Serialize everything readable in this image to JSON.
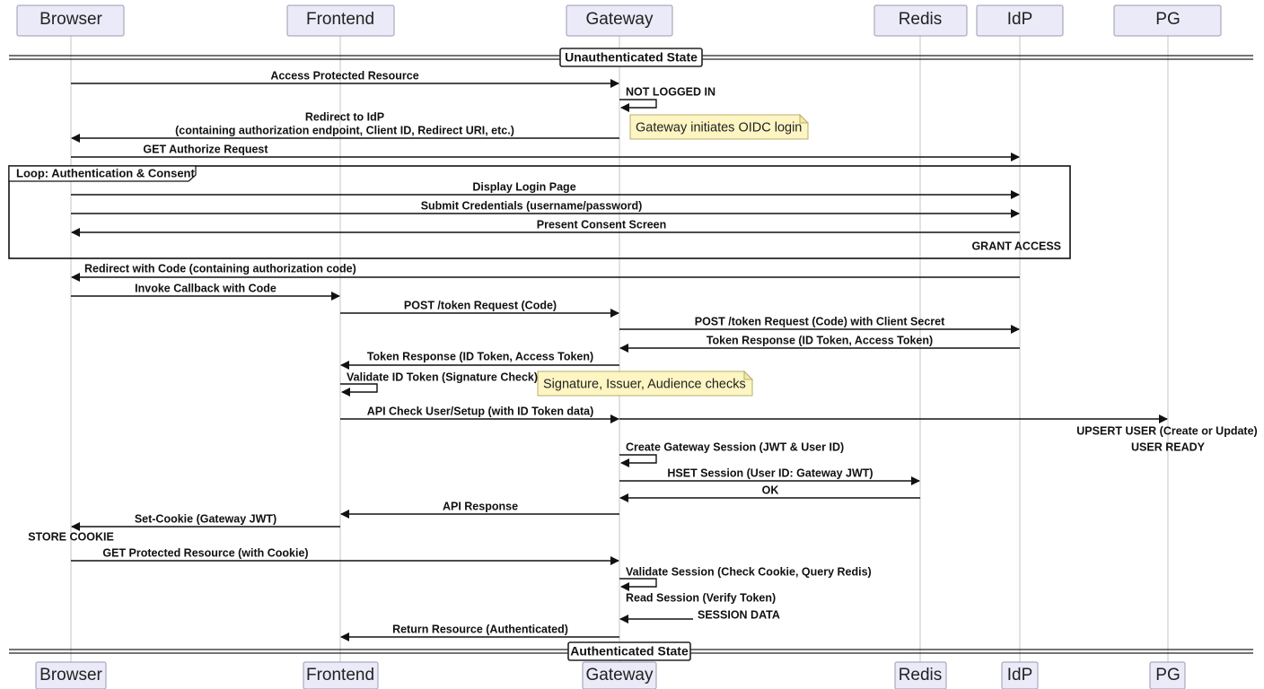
{
  "participants": [
    {
      "id": "browser",
      "label": "Browser"
    },
    {
      "id": "frontend",
      "label": "Frontend"
    },
    {
      "id": "gateway",
      "label": "Gateway"
    },
    {
      "id": "redis",
      "label": "Redis"
    },
    {
      "id": "idp",
      "label": "IdP"
    },
    {
      "id": "pg",
      "label": "PG"
    }
  ],
  "dividers": {
    "top": "Unauthenticated State",
    "bottom": "Authenticated State"
  },
  "loop": {
    "label": "Loop: Authentication & Consent"
  },
  "messages": [
    {
      "from": "browser",
      "to": "gateway",
      "lines": [
        "Access Protected Resource"
      ]
    },
    {
      "from": "gateway",
      "to": "gateway",
      "lines": [
        "NOT LOGGED IN"
      ]
    },
    {
      "from": "gateway",
      "to": "browser",
      "lines": [
        "Redirect to IdP",
        "(containing authorization endpoint, Client ID, Redirect URI, etc.)"
      ]
    },
    {
      "from": "browser",
      "to": "idp",
      "lines": [
        "GET Authorize Request"
      ]
    },
    {
      "from": "browser",
      "to": "idp",
      "lines": [
        "Display Login Page"
      ]
    },
    {
      "from": "browser",
      "to": "idp",
      "lines": [
        "Submit Credentials (username/password)"
      ]
    },
    {
      "from": "idp",
      "to": "browser",
      "lines": [
        "Present Consent Screen"
      ]
    },
    {
      "from": "idp",
      "to": "browser",
      "lines": [
        "Redirect with Code (containing authorization code)"
      ]
    },
    {
      "from": "browser",
      "to": "frontend",
      "lines": [
        "Invoke Callback with Code"
      ]
    },
    {
      "from": "frontend",
      "to": "gateway",
      "lines": [
        "POST /token Request (Code)"
      ]
    },
    {
      "from": "gateway",
      "to": "idp",
      "lines": [
        "POST /token Request (Code) with Client Secret"
      ]
    },
    {
      "from": "idp",
      "to": "gateway",
      "lines": [
        "Token Response (ID Token, Access Token)"
      ]
    },
    {
      "from": "gateway",
      "to": "frontend",
      "lines": [
        "Token Response (ID Token, Access Token)"
      ]
    },
    {
      "from": "frontend",
      "to": "frontend",
      "lines": [
        "Validate ID Token (Signature Check)"
      ]
    },
    {
      "from": "frontend",
      "to": "gateway",
      "lines": [
        "API Check User/Setup (with ID Token data)"
      ]
    },
    {
      "from": "gateway",
      "to": "pg",
      "lines": []
    },
    {
      "from": "gateway",
      "to": "gateway",
      "lines": [
        "Create Gateway Session (JWT & User ID)"
      ]
    },
    {
      "from": "gateway",
      "to": "redis",
      "lines": [
        "HSET Session (User ID: Gateway JWT)"
      ]
    },
    {
      "from": "redis",
      "to": "gateway",
      "lines": [
        "OK"
      ]
    },
    {
      "from": "gateway",
      "to": "frontend",
      "lines": [
        "API Response"
      ]
    },
    {
      "from": "frontend",
      "to": "browser",
      "lines": [
        "Set-Cookie (Gateway JWT)"
      ]
    },
    {
      "from": "browser",
      "to": "gateway",
      "lines": [
        "GET Protected Resource (with Cookie)"
      ]
    },
    {
      "from": "gateway",
      "to": "gateway",
      "lines": [
        "Validate Session (Check Cookie, Query Redis)"
      ]
    },
    {
      "from": "gateway",
      "to": "gateway",
      "lines": [
        "Read Session (Verify Token)"
      ]
    },
    {
      "from": "gateway",
      "to": "frontend",
      "lines": [
        "Return Resource (Authenticated)"
      ]
    }
  ],
  "notes": [
    {
      "text": "Gateway initiates OIDC login"
    },
    {
      "text": "Signature, Issuer, Audience checks"
    }
  ],
  "labels": [
    {
      "text": "GRANT ACCESS"
    },
    {
      "text": "UPSERT USER (Create or Update)"
    },
    {
      "text": "USER READY"
    },
    {
      "text": "STORE COOKIE"
    },
    {
      "text": "SESSION DATA"
    }
  ]
}
